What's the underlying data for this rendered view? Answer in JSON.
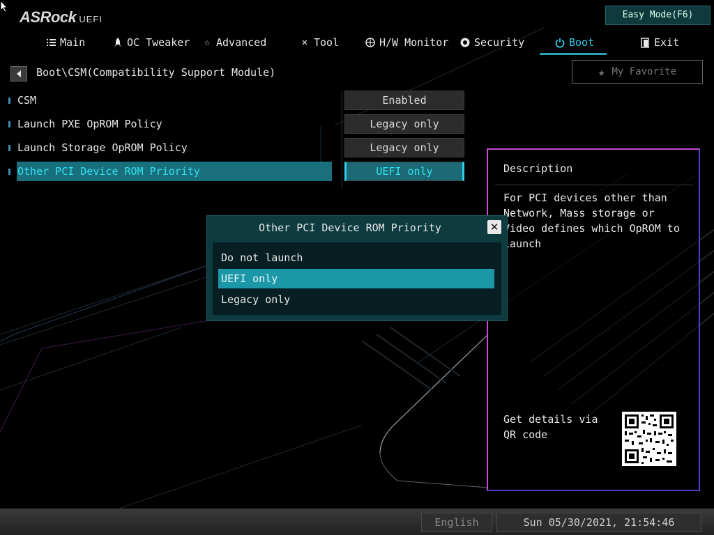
{
  "header": {
    "brand": "ASRock",
    "brand_sub": "UEFI",
    "easy_mode": "Easy Mode(F6)"
  },
  "nav": {
    "tabs": [
      {
        "label": "Main",
        "icon": "list-icon"
      },
      {
        "label": "OC Tweaker",
        "icon": "rocket-icon"
      },
      {
        "label": "Advanced",
        "icon": "star-icon"
      },
      {
        "label": "Tool",
        "icon": "tools-icon"
      },
      {
        "label": "H/W Monitor",
        "icon": "monitor-icon"
      },
      {
        "label": "Security",
        "icon": "shield-icon"
      },
      {
        "label": "Boot",
        "icon": "power-icon",
        "active": true
      },
      {
        "label": "Exit",
        "icon": "exit-icon"
      }
    ]
  },
  "breadcrumb": "Boot\\CSM(Compatibility Support Module)",
  "favorite": "My Favorite",
  "settings": [
    {
      "label": "CSM",
      "value": "Enabled"
    },
    {
      "label": "Launch PXE OpROM Policy",
      "value": "Legacy only"
    },
    {
      "label": "Launch Storage OpROM Policy",
      "value": "Legacy only"
    },
    {
      "label": "Other PCI Device ROM Priority",
      "value": "UEFI only",
      "selected": true
    }
  ],
  "description": {
    "title": "Description",
    "text": "For PCI devices other than Network, Mass storage or Video defines which OpROM to launch",
    "qr_text": "Get details via QR code"
  },
  "popup": {
    "title": "Other PCI Device ROM Priority",
    "options": [
      "Do not launch",
      "UEFI only",
      "Legacy only"
    ],
    "selected": "UEFI only"
  },
  "footer": {
    "language": "English",
    "datetime": "Sun 05/30/2021, 21:54:46"
  },
  "colors": {
    "accent": "#2fd0ee",
    "selection": "#1a6f7c",
    "popup_bg": "#0d3b3f"
  }
}
